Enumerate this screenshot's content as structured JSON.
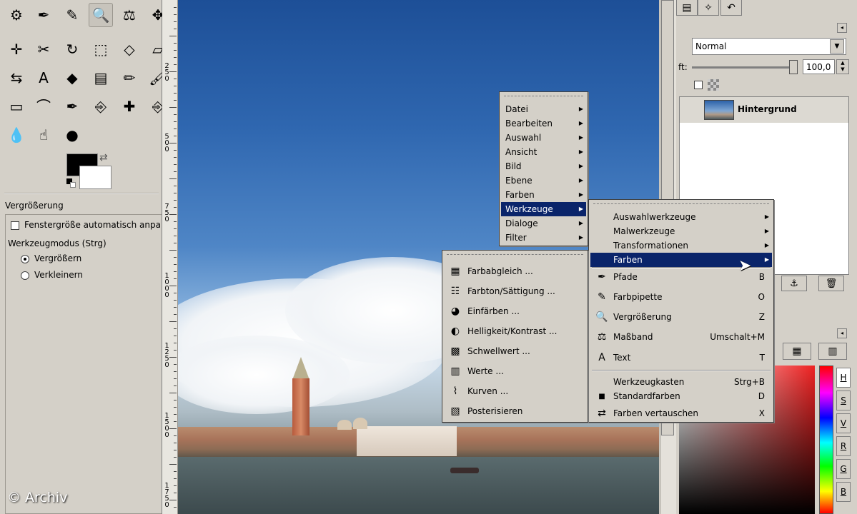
{
  "toolbox": {
    "tools": [
      {
        "name": "fuzzy-select-icon",
        "glyph": "⚙"
      },
      {
        "name": "paths-icon",
        "glyph": "✒"
      },
      {
        "name": "color-picker-icon",
        "glyph": "✎"
      },
      {
        "name": "zoom-icon",
        "glyph": "🔍",
        "active": true
      },
      {
        "name": "measure-icon",
        "glyph": "⚖"
      },
      {
        "name": "align-icon",
        "glyph": "✥"
      },
      {
        "name": "move-icon",
        "glyph": "✛"
      },
      {
        "name": "crop-icon",
        "glyph": "✂"
      },
      {
        "name": "rotate-icon",
        "glyph": "↻"
      },
      {
        "name": "scale-icon",
        "glyph": "⬚"
      },
      {
        "name": "perspective-icon",
        "glyph": "◇"
      },
      {
        "name": "shear-icon",
        "glyph": "▱"
      },
      {
        "name": "flip-icon",
        "glyph": "⇆"
      },
      {
        "name": "text-icon",
        "glyph": "A"
      },
      {
        "name": "bucket-fill-icon",
        "glyph": "◆"
      },
      {
        "name": "blend-icon",
        "glyph": "▤"
      },
      {
        "name": "pencil-icon",
        "glyph": "✏"
      },
      {
        "name": "paintbrush-icon",
        "glyph": "🖌"
      },
      {
        "name": "eraser-icon",
        "glyph": "▭"
      },
      {
        "name": "airbrush-icon",
        "glyph": "⌒"
      },
      {
        "name": "ink-icon",
        "glyph": "✒"
      },
      {
        "name": "clone-icon",
        "glyph": "⎆"
      },
      {
        "name": "heal-icon",
        "glyph": "✚"
      },
      {
        "name": "perspective-clone-icon",
        "glyph": "⎆"
      },
      {
        "name": "blur-icon",
        "glyph": "💧"
      },
      {
        "name": "smudge-icon",
        "glyph": "☝"
      },
      {
        "name": "dodge-burn-icon",
        "glyph": "●"
      }
    ],
    "fg_color": "#000000",
    "bg_color": "#ffffff",
    "options": {
      "title": "Vergrößerung",
      "auto_resize": "Fenstergröße automatisch anpassen",
      "mode_label": "Werkzeugmodus  (Strg)",
      "mode_in": "Vergrößern",
      "mode_out": "Verkleinern"
    }
  },
  "ruler": {
    "marks": [
      "2\n5\n0",
      "5\n0\n0",
      "7\n5\n0",
      "1\n0\n0\n0",
      "1\n2\n5\n0",
      "1\n5\n0\n0",
      "1\n7\n5\n0"
    ]
  },
  "layers": {
    "mode": "Normal",
    "opacity_label": "ft:",
    "opacity_value": "100,0",
    "layer_name": "Hintergrund"
  },
  "color_channels": [
    "H",
    "S",
    "V",
    "R",
    "G",
    "B"
  ],
  "main_menu": {
    "items": [
      {
        "label": "Datei",
        "submenu": true
      },
      {
        "label": "Bearbeiten",
        "submenu": true
      },
      {
        "label": "Auswahl",
        "submenu": true
      },
      {
        "label": "Ansicht",
        "submenu": true
      },
      {
        "label": "Bild",
        "submenu": true
      },
      {
        "label": "Ebene",
        "submenu": true
      },
      {
        "label": "Farben",
        "submenu": true
      },
      {
        "label": "Werkzeuge",
        "submenu": true,
        "highlight": true
      },
      {
        "label": "Dialoge",
        "submenu": true
      },
      {
        "label": "Filter",
        "submenu": true
      }
    ]
  },
  "tools_menu": {
    "items": [
      {
        "label": "Auswahlwerkzeuge",
        "submenu": true
      },
      {
        "label": "Malwerkzeuge",
        "submenu": true
      },
      {
        "label": "Transformationen",
        "submenu": true
      },
      {
        "label": "Farben",
        "submenu": true,
        "highlight": true
      },
      {
        "label": "Pfade",
        "shortcut": "B",
        "icon": "paths-icon",
        "glyph": "✒"
      },
      {
        "label": "Farbpipette",
        "shortcut": "O",
        "icon": "color-picker-icon",
        "glyph": "✎"
      },
      {
        "label": "Vergrößerung",
        "shortcut": "Z",
        "icon": "zoom-icon",
        "glyph": "🔍"
      },
      {
        "label": "Maßband",
        "shortcut": "Umschalt+M",
        "icon": "measure-icon",
        "glyph": "⚖"
      },
      {
        "label": "Text",
        "shortcut": "T",
        "icon": "text-icon",
        "glyph": "A"
      },
      {
        "label": "Werkzeugkasten",
        "shortcut": "Strg+B"
      },
      {
        "label": "Standardfarben",
        "shortcut": "D",
        "icon": "default-colors-icon",
        "glyph": "◾"
      },
      {
        "label": "Farben vertauschen",
        "shortcut": "X",
        "icon": "swap-colors-icon",
        "glyph": "⇄"
      }
    ]
  },
  "colors_menu": {
    "items": [
      {
        "label": "Farbabgleich ...",
        "icon": "color-balance-icon",
        "glyph": "▦"
      },
      {
        "label": "Farbton/Sättigung ...",
        "icon": "hue-saturation-icon",
        "glyph": "☷"
      },
      {
        "label": "Einfärben ...",
        "icon": "colorize-icon",
        "glyph": "◕"
      },
      {
        "label": "Helligkeit/Kontrast ...",
        "icon": "brightness-contrast-icon",
        "glyph": "◐"
      },
      {
        "label": "Schwellwert ...",
        "icon": "threshold-icon",
        "glyph": "▩"
      },
      {
        "label": "Werte ...",
        "icon": "levels-icon",
        "glyph": "▥"
      },
      {
        "label": "Kurven ...",
        "icon": "curves-icon",
        "glyph": "⌇"
      },
      {
        "label": "Posterisieren",
        "icon": "posterize-icon",
        "glyph": "▧"
      }
    ]
  },
  "watermark": "© Archiv"
}
